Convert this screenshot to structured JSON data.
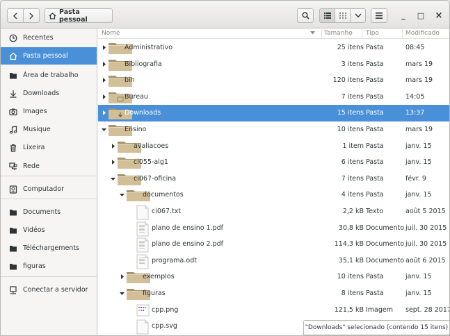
{
  "header": {
    "back_icon": "chevron-left-icon",
    "forward_icon": "chevron-right-icon",
    "path_label": "Pasta pessoal",
    "search_icon": "search-icon",
    "list_view_icon": "list-view-icon",
    "grid_view_icon": "grid-view-icon",
    "menu_icon": "hamburger-menu-icon",
    "minimize_label": "_",
    "maximize_label": "□",
    "close_label": "×"
  },
  "sidebar": {
    "items": [
      {
        "label": "Recentes",
        "icon": "clock-icon"
      },
      {
        "label": "Pasta pessoal",
        "icon": "home-icon",
        "active": true
      },
      {
        "label": "Área de trabalho",
        "icon": "desktop-folder-icon"
      },
      {
        "label": "Downloads",
        "icon": "download-arrow-icon"
      },
      {
        "label": "Images",
        "icon": "camera-icon"
      },
      {
        "label": "Musique",
        "icon": "music-note-icon"
      },
      {
        "label": "Lixeira",
        "icon": "trash-icon"
      },
      {
        "label": "Rede",
        "icon": "network-icon"
      },
      {
        "label": "Computador",
        "icon": "drive-icon"
      },
      {
        "label": "Documents",
        "icon": "folder-icon"
      },
      {
        "label": "Vidéos",
        "icon": "folder-icon"
      },
      {
        "label": "Téléchargements",
        "icon": "folder-icon"
      },
      {
        "label": "figuras",
        "icon": "folder-icon"
      },
      {
        "label": "Conectar a servidor",
        "icon": "server-icon"
      }
    ]
  },
  "columns": {
    "name": "Nome",
    "size": "Tamanho",
    "type": "Tipo",
    "modified": "Modificado"
  },
  "rows": [
    {
      "name": "Administrativo",
      "size": "25 itens",
      "type": "Pasta",
      "modified": "08:45",
      "kind": "folder",
      "depth": 0,
      "expander": "collapsed"
    },
    {
      "name": "Bibliografia",
      "size": "3 itens",
      "type": "Pasta",
      "modified": "mars 19",
      "kind": "folder",
      "depth": 0,
      "expander": "collapsed"
    },
    {
      "name": "bin",
      "size": "120 itens",
      "type": "Pasta",
      "modified": "mars 19",
      "kind": "folder",
      "depth": 0,
      "expander": "collapsed"
    },
    {
      "name": "Bureau",
      "size": "7 itens",
      "type": "Pasta",
      "modified": "14:05",
      "kind": "folder-special",
      "depth": 0,
      "expander": "collapsed"
    },
    {
      "name": "Downloads",
      "size": "15 itens",
      "type": "Pasta",
      "modified": "13:37",
      "kind": "folder-download",
      "depth": 0,
      "expander": "collapsed",
      "selected": true
    },
    {
      "name": "Ensino",
      "size": "10 itens",
      "type": "Pasta",
      "modified": "mars 19",
      "kind": "folder",
      "depth": 0,
      "expander": "expanded"
    },
    {
      "name": "avaliacoes",
      "size": "1 item",
      "type": "Pasta",
      "modified": "janv. 15",
      "kind": "folder",
      "depth": 1,
      "expander": "collapsed"
    },
    {
      "name": "ci055-alg1",
      "size": "6 itens",
      "type": "Pasta",
      "modified": "janv. 15",
      "kind": "folder",
      "depth": 1,
      "expander": "collapsed"
    },
    {
      "name": "ci067-oficina",
      "size": "7 itens",
      "type": "Pasta",
      "modified": "févr. 9",
      "kind": "folder",
      "depth": 1,
      "expander": "expanded"
    },
    {
      "name": "documentos",
      "size": "4 itens",
      "type": "Pasta",
      "modified": "janv. 15",
      "kind": "folder",
      "depth": 2,
      "expander": "expanded"
    },
    {
      "name": "ci067.txt",
      "size": "2,2 kB",
      "type": "Texto",
      "modified": "août 5 2015",
      "kind": "text-file",
      "depth": 3,
      "expander": "none"
    },
    {
      "name": "plano de ensino 1.pdf",
      "size": "30,8 kB",
      "type": "Documento",
      "modified": "juil. 30 2015",
      "kind": "pdf-file",
      "depth": 3,
      "expander": "none"
    },
    {
      "name": "plano de ensino 2.pdf",
      "size": "114,3 kB",
      "type": "Documento",
      "modified": "juil. 30 2015",
      "kind": "pdf-file",
      "depth": 3,
      "expander": "none"
    },
    {
      "name": "programa.odt",
      "size": "35,1 kB",
      "type": "Documento",
      "modified": "août 6 2015",
      "kind": "odt-file",
      "depth": 3,
      "expander": "none"
    },
    {
      "name": "exemplos",
      "size": "10 itens",
      "type": "Pasta",
      "modified": "janv. 15",
      "kind": "folder",
      "depth": 2,
      "expander": "collapsed"
    },
    {
      "name": "figuras",
      "size": "8 itens",
      "type": "Pasta",
      "modified": "janv. 15",
      "kind": "folder",
      "depth": 2,
      "expander": "expanded"
    },
    {
      "name": "cpp.png",
      "size": "121,5 kB",
      "type": "Imagem",
      "modified": "sept. 28 2017",
      "kind": "image-file",
      "depth": 3,
      "expander": "none"
    },
    {
      "name": "cpp.svg",
      "size": "",
      "type": "",
      "modified": "",
      "kind": "svg-file",
      "depth": 3,
      "expander": "none"
    }
  ],
  "status": "\"Downloads\" selecionado  (contendo 15 itens)",
  "colors": {
    "accent": "#4a90d9",
    "folder": "#c7b28c"
  }
}
